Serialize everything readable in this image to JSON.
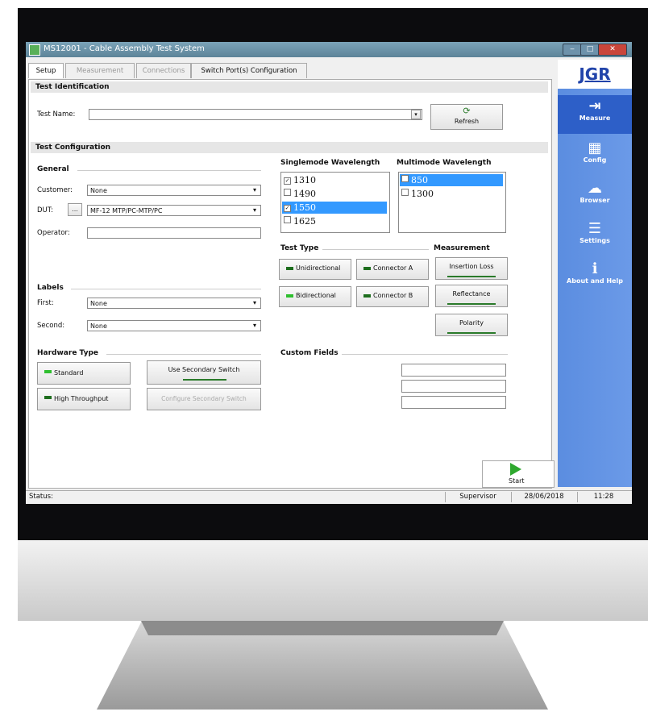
{
  "window": {
    "title": "MS12001 - Cable Assembly Test System"
  },
  "tabs": [
    {
      "label": "Setup",
      "enabled": true
    },
    {
      "label": "Measurement",
      "enabled": false
    },
    {
      "label": "Connections",
      "enabled": false
    },
    {
      "label": "Switch Port(s) Configuration",
      "enabled": true
    }
  ],
  "test_identification": {
    "header": "Test Identification",
    "test_name_label": "Test Name:",
    "test_name_value": "",
    "refresh_label": "Refresh"
  },
  "test_configuration": {
    "header": "Test Configuration",
    "general": {
      "header": "General",
      "customer_label": "Customer:",
      "customer_value": "None",
      "dut_label": "DUT:",
      "dut_browse": "...",
      "dut_value": "MF-12 MTP/PC-MTP/PC",
      "operator_label": "Operator:",
      "operator_value": ""
    },
    "labels": {
      "header": "Labels",
      "first_label": "First:",
      "first_value": "None",
      "second_label": "Second:",
      "second_value": "None"
    },
    "hardware_type": {
      "header": "Hardware Type",
      "standard": "Standard",
      "high_throughput": "High Throughput",
      "use_secondary_switch": "Use Secondary Switch",
      "configure_secondary_switch": "Configure Secondary Switch"
    },
    "singlemode": {
      "header": "Singlemode Wavelength",
      "items": [
        {
          "label": "1310",
          "checked": true,
          "selected": false
        },
        {
          "label": "1490",
          "checked": false,
          "selected": false
        },
        {
          "label": "1550",
          "checked": true,
          "selected": true
        },
        {
          "label": "1625",
          "checked": false,
          "selected": false
        }
      ]
    },
    "multimode": {
      "header": "Multimode Wavelength",
      "items": [
        {
          "label": "850",
          "checked": false,
          "selected": true
        },
        {
          "label": "1300",
          "checked": false,
          "selected": false
        }
      ]
    },
    "test_type": {
      "header": "Test Type",
      "unidirectional": "Unidirectional",
      "bidirectional": "Bidirectional",
      "connector_a": "Connector A",
      "connector_b": "Connector B"
    },
    "measurement": {
      "header": "Measurement",
      "insertion_loss": "Insertion Loss",
      "reflectance": "Reflectance",
      "polarity": "Polarity"
    },
    "custom_fields": {
      "header": "Custom Fields"
    }
  },
  "side_nav": {
    "logo": "JGR",
    "items": [
      {
        "label": "Measure",
        "icon": "measure-icon"
      },
      {
        "label": "Config",
        "icon": "config-icon"
      },
      {
        "label": "Browser",
        "icon": "browser-icon"
      },
      {
        "label": "Settings",
        "icon": "settings-icon"
      },
      {
        "label": "About and Help",
        "icon": "info-icon"
      }
    ]
  },
  "start_label": "Start",
  "status_bar": {
    "status_label": "Status:",
    "user": "Supervisor",
    "date": "28/06/2018",
    "time": "11:28"
  },
  "colors": {
    "led_green": "#1e8c1e",
    "selection_blue": "#3399ff",
    "side_panel_blue": "#5b8de0"
  }
}
